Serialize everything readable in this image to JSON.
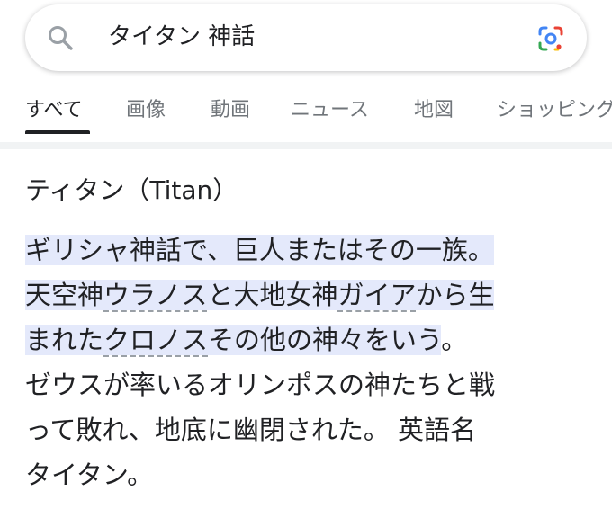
{
  "search": {
    "query": "タイタン 神話"
  },
  "tabs": [
    {
      "label": "すべて",
      "active": true
    },
    {
      "label": "画像",
      "active": false
    },
    {
      "label": "動画",
      "active": false
    },
    {
      "label": "ニュース",
      "active": false
    },
    {
      "label": "地図",
      "active": false
    },
    {
      "label": "ショッピング",
      "active": false
    }
  ],
  "result": {
    "heading": "ティタン（Titan）",
    "lines": [
      {
        "segments": [
          "ギリシャ神話で、巨人またはその一族。"
        ]
      },
      {
        "segments": [
          "天空神",
          "ウラノス",
          "と大地女神",
          "ガイア",
          "から生"
        ]
      },
      {
        "segments": [
          "まれた",
          "クロノス",
          "その他の神々をいう",
          "。"
        ]
      },
      {
        "segments": [
          "ゼウスが率いるオリンポスの神たちと戦"
        ]
      },
      {
        "segments": [
          "って敗れ、地底に幽閉された。 英語名"
        ]
      },
      {
        "segments": [
          "タイタン。"
        ]
      }
    ]
  },
  "colors": {
    "highlight": "#e4e9fb",
    "text": "#202124",
    "muted_tab": "#70757a"
  },
  "icons": {
    "search": "search-icon",
    "lens": "google-lens-icon"
  }
}
